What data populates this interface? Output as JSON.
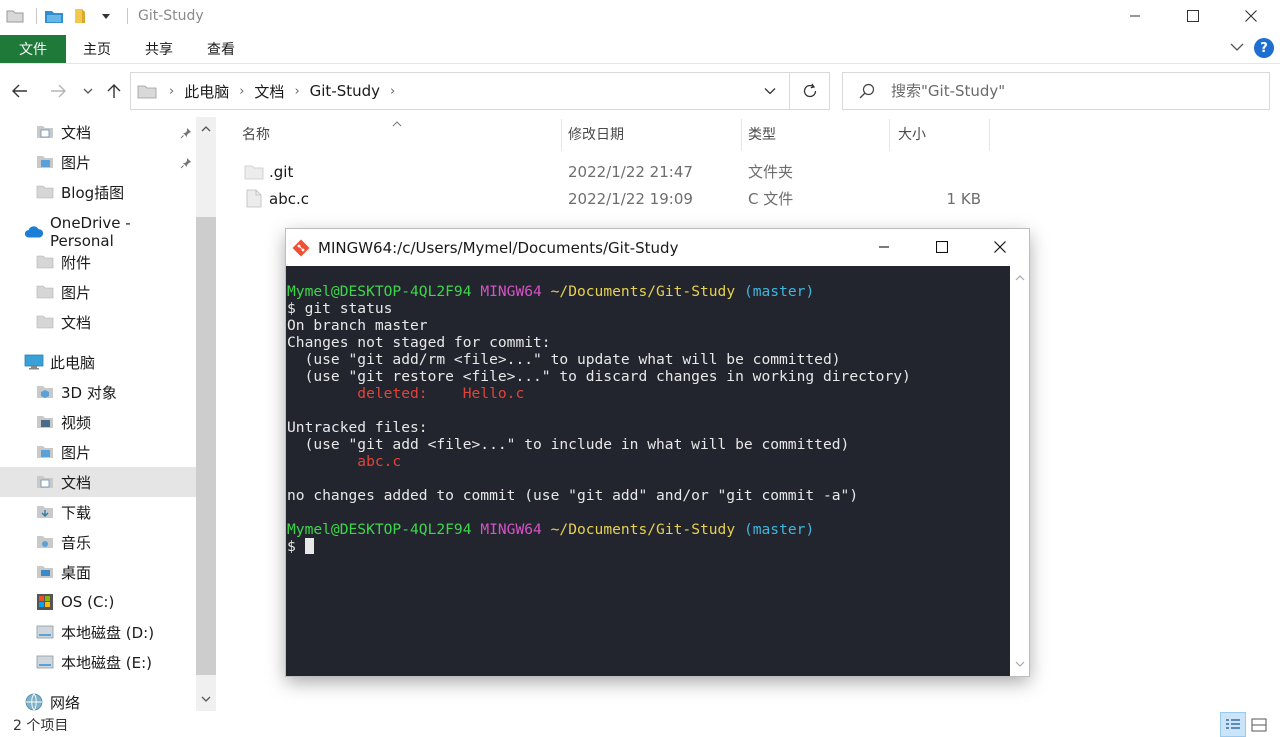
{
  "window": {
    "title": "Git-Study"
  },
  "ribbon": {
    "tabs": [
      "文件",
      "主页",
      "共享",
      "查看"
    ]
  },
  "address": {
    "crumbs": [
      "此电脑",
      "文档",
      "Git-Study"
    ]
  },
  "search": {
    "placeholder": "搜索\"Git-Study\""
  },
  "nav": {
    "items": [
      {
        "label": "文档",
        "icon": "documents-icon",
        "pinned": true
      },
      {
        "label": "图片",
        "icon": "pictures-icon",
        "pinned": true
      },
      {
        "label": "Blog插图",
        "icon": "folder-icon",
        "pinned": false
      },
      {
        "label": "OneDrive - Personal",
        "icon": "onedrive-cloud-icon",
        "pinned": false
      },
      {
        "label": "附件",
        "icon": "folder-icon",
        "pinned": false
      },
      {
        "label": "图片",
        "icon": "folder-icon",
        "pinned": false
      },
      {
        "label": "文档",
        "icon": "folder-icon",
        "pinned": false
      },
      {
        "label": "此电脑",
        "icon": "this-pc-icon",
        "pinned": false
      },
      {
        "label": "3D 对象",
        "icon": "3d-objects-icon",
        "pinned": false
      },
      {
        "label": "视频",
        "icon": "videos-icon",
        "pinned": false
      },
      {
        "label": "图片",
        "icon": "pictures-icon",
        "pinned": false
      },
      {
        "label": "文档",
        "icon": "documents-icon",
        "pinned": false,
        "selected": true
      },
      {
        "label": "下载",
        "icon": "downloads-icon",
        "pinned": false
      },
      {
        "label": "音乐",
        "icon": "music-icon",
        "pinned": false
      },
      {
        "label": "桌面",
        "icon": "desktop-icon",
        "pinned": false
      },
      {
        "label": "OS (C:)",
        "icon": "windows-drive-icon",
        "pinned": false
      },
      {
        "label": "本地磁盘 (D:)",
        "icon": "drive-icon",
        "pinned": false
      },
      {
        "label": "本地磁盘 (E:)",
        "icon": "drive-icon",
        "pinned": false
      },
      {
        "label": "网络",
        "icon": "network-icon",
        "pinned": false
      }
    ]
  },
  "files": {
    "columns": [
      "名称",
      "修改日期",
      "类型",
      "大小"
    ],
    "rows": [
      {
        "name": ".git",
        "modified": "2022/1/22 21:47",
        "type": "文件夹",
        "size": "",
        "icon": "folder-icon"
      },
      {
        "name": "abc.c",
        "modified": "2022/1/22 19:09",
        "type": "C 文件",
        "size": "1 KB",
        "icon": "file-icon"
      }
    ]
  },
  "status": {
    "item_count": "2 个项目"
  },
  "terminal": {
    "title": "MINGW64:/c/Users/Mymel/Documents/Git-Study",
    "prompt_user": "Mymel@DESKTOP-4QL2F94",
    "prompt_env": "MINGW64",
    "prompt_path": "~/Documents/Git-Study",
    "prompt_branch": "(master)",
    "lines": {
      "cmd": "$ git status",
      "on_branch": "On branch master",
      "not_staged": "Changes not staged for commit:",
      "hint_update": "  (use \"git add/rm <file>...\" to update what will be committed)",
      "hint_restore": "  (use \"git restore <file>...\" to discard changes in working directory)",
      "deleted_label": "        deleted:    ",
      "deleted_file": "Hello.c",
      "untracked": "Untracked files:",
      "hint_include": "  (use \"git add <file>...\" to include in what will be committed)",
      "untracked_file": "        abc.c",
      "no_changes": "no changes added to commit (use \"git add\" and/or \"git commit -a\")",
      "prompt_end": "$ "
    },
    "colors": {
      "background": "#23252e",
      "user": "#3dd64b",
      "env": "#d652c6",
      "path": "#e7d14f",
      "branch": "#3fb6dd",
      "red": "#e0453b"
    }
  },
  "theme": {
    "file_tab_green": "#1f7a3a",
    "help_blue": "#1f6fd0",
    "selection_gray": "#e5e5e5"
  }
}
